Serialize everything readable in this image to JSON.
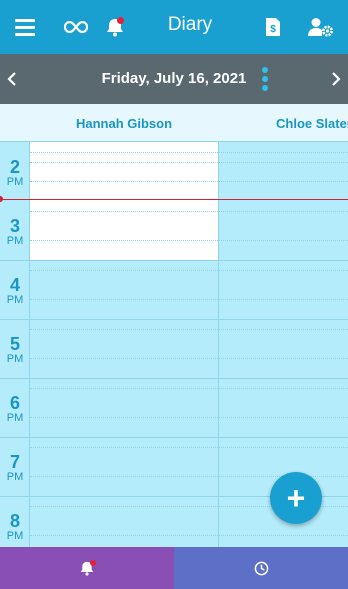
{
  "app": {
    "title": "Diary"
  },
  "header": {
    "date": "Friday, July 16, 2021"
  },
  "columns": [
    {
      "name": "Hannah Gibson"
    },
    {
      "name": "Chloe Slater"
    }
  ],
  "hours": [
    {
      "num": "2",
      "ampm": "PM"
    },
    {
      "num": "3",
      "ampm": "PM"
    },
    {
      "num": "4",
      "ampm": "PM"
    },
    {
      "num": "5",
      "ampm": "PM"
    },
    {
      "num": "6",
      "ampm": "PM"
    },
    {
      "num": "7",
      "ampm": "PM"
    },
    {
      "num": "8",
      "ampm": "PM"
    }
  ],
  "icons": {
    "menu": "menu-icon",
    "infinity": "infinity-icon",
    "notifications": "bell-icon",
    "invoice": "invoice-icon",
    "user_settings": "user-settings-icon",
    "prev": "chevron-left-icon",
    "next": "chevron-right-icon",
    "more": "kebab-icon",
    "add": "plus-icon",
    "clock": "clock-icon"
  },
  "colors": {
    "primary": "#1a9fd1",
    "datebar": "#5a6970",
    "grid_bg": "#b5ecfb",
    "now_line": "#d22136",
    "nav_left": "#8a4fb4",
    "nav_right": "#5e6fc7",
    "badge": "#e5213a"
  },
  "fab": {
    "label": "+"
  }
}
